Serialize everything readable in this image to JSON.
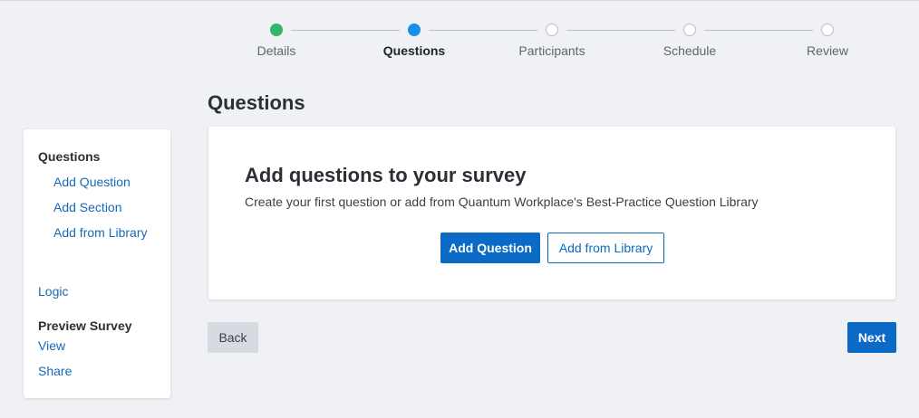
{
  "stepper": {
    "steps": [
      {
        "label": "Details",
        "state": "done"
      },
      {
        "label": "Questions",
        "state": "active"
      },
      {
        "label": "Participants",
        "state": "pending"
      },
      {
        "label": "Schedule",
        "state": "pending"
      },
      {
        "label": "Review",
        "state": "pending"
      }
    ]
  },
  "page": {
    "title": "Questions"
  },
  "sidebar": {
    "questions_heading": "Questions",
    "add_question": "Add Question",
    "add_section": "Add Section",
    "add_from_library": "Add from Library",
    "logic": "Logic",
    "preview_heading": "Preview Survey",
    "view": "View",
    "share": "Share"
  },
  "card": {
    "title": "Add questions to your survey",
    "subtitle": "Create your first question or add from Quantum Workplace's Best-Practice Question Library",
    "add_question_button": "Add Question",
    "add_from_library_button": "Add from Library"
  },
  "footer": {
    "back_label": "Back",
    "next_label": "Next"
  },
  "colors": {
    "accent": "#0a6ac6",
    "step_done": "#2fb86a",
    "step_active": "#1a8fe8",
    "link": "#1668b8",
    "background": "#f0f1f5"
  }
}
